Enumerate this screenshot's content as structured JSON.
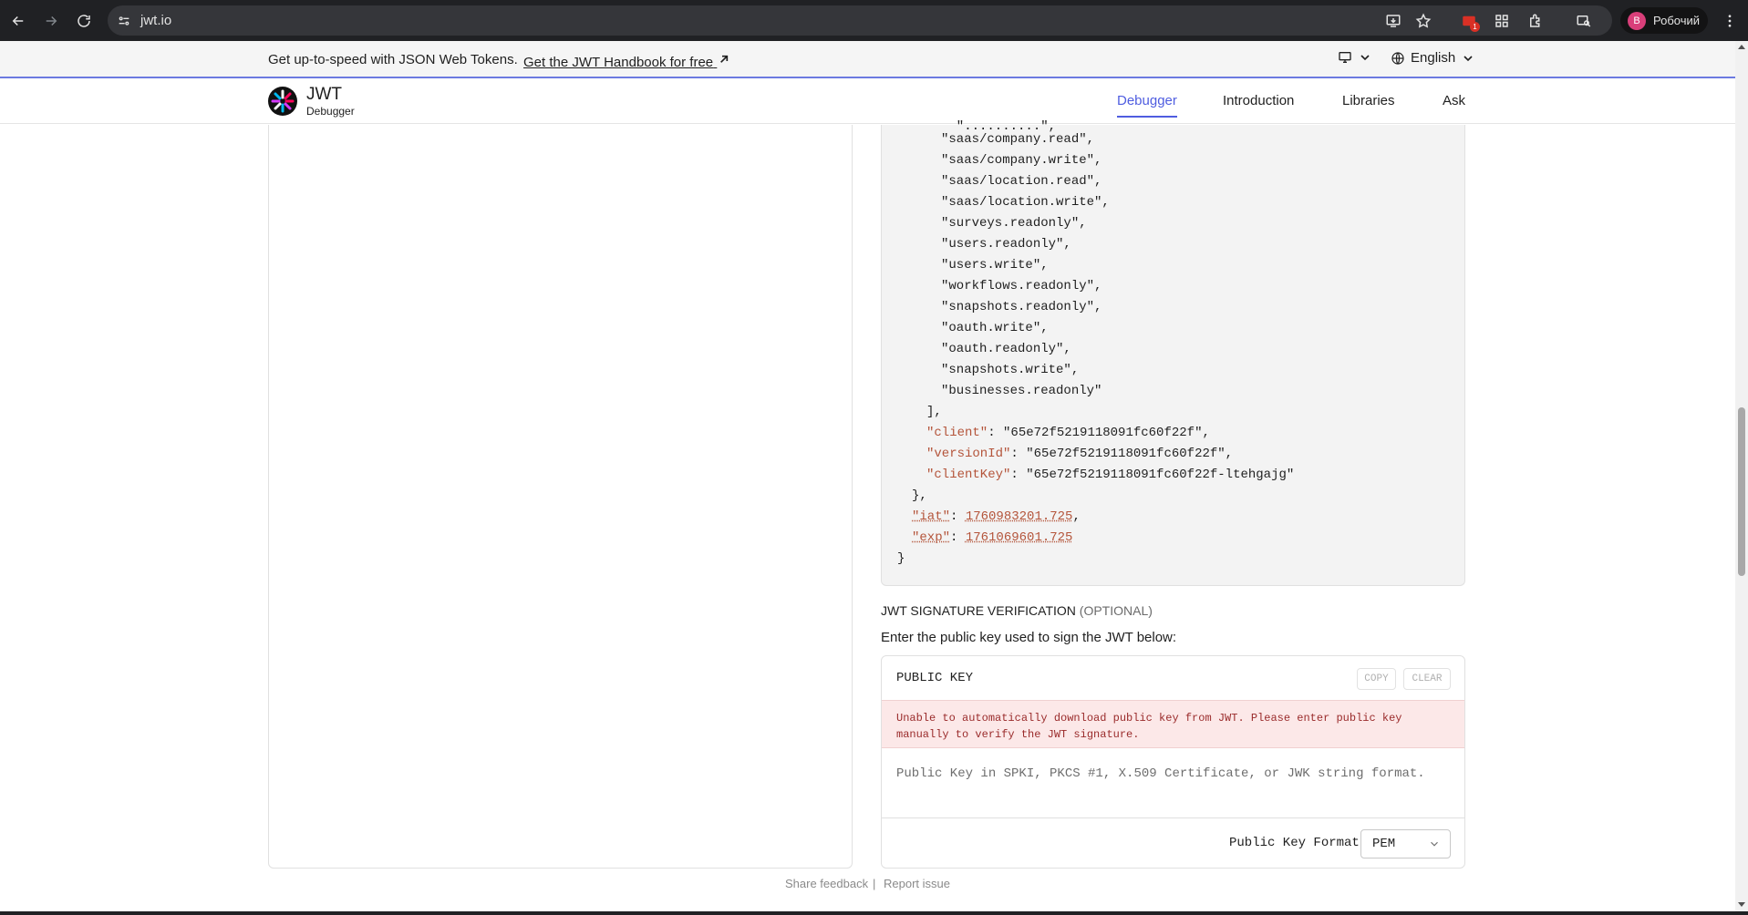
{
  "browser": {
    "url": "jwt.io",
    "profile_name": "Робочий",
    "profile_initial": "В",
    "extension_badge": "1"
  },
  "promo": {
    "text": "Get up-to-speed with JSON Web Tokens.",
    "link": "Get the JWT Handbook for free",
    "language": "English"
  },
  "header": {
    "brand": "JWT",
    "brand_sub": "Debugger",
    "nav": [
      "Debugger",
      "Introduction",
      "Libraries",
      "Ask"
    ],
    "active_nav": "Debugger"
  },
  "payload": {
    "scopes": [
      "\"saas/company.read\",",
      "\"saas/company.write\",",
      "\"saas/location.read\",",
      "\"saas/location.write\",",
      "\"surveys.readonly\",",
      "\"users.readonly\",",
      "\"users.write\",",
      "\"workflows.readonly\",",
      "\"snapshots.readonly\",",
      "\"oauth.write\",",
      "\"oauth.readonly\",",
      "\"snapshots.write\",",
      "\"businesses.readonly\""
    ],
    "array_close": "],",
    "client_key": "\"client\"",
    "client_value": "\"65e72f5219118091fc60f22f\",",
    "version_key": "\"versionId\"",
    "version_value": "\"65e72f5219118091fc60f22f\",",
    "clientkey_key": "\"clientKey\"",
    "clientkey_value": "\"65e72f5219118091fc60f22f-ltehgajg\"",
    "object_close": "},",
    "iat_key": "\"iat\"",
    "iat_value": "1760983201.725",
    "exp_key": "\"exp\"",
    "exp_value": "1761069601.725",
    "root_close": "}"
  },
  "signature": {
    "title": "JWT SIGNATURE VERIFICATION",
    "optional": "(OPTIONAL)",
    "description": "Enter the public key used to sign the JWT below:",
    "card_title": "PUBLIC KEY",
    "copy_label": "COPY",
    "clear_label": "CLEAR",
    "error": "Unable to automatically download public key from JWT. Please enter public key manually to verify the JWT signature.",
    "placeholder": "Public Key in SPKI, PKCS #1, X.509 Certificate, or JWK string format.",
    "format_label": "Public Key Format",
    "format_value": "PEM"
  },
  "footer": {
    "feedback": "Share feedback",
    "separator": "|",
    "report": "Report issue"
  },
  "colors": {
    "accent": "#4f5de0",
    "json_key": "#b4543a",
    "error_bg": "#fce8e8",
    "error_text": "#9a2b2b"
  }
}
